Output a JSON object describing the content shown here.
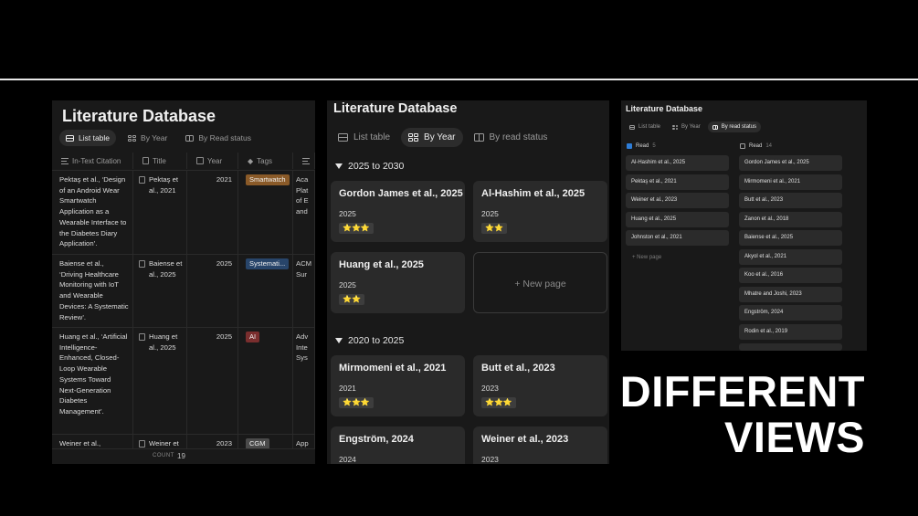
{
  "views": {
    "list": {
      "title": "Literature Database",
      "tabs": [
        {
          "label": "List table",
          "icon": "table-icon",
          "active": true
        },
        {
          "label": "By Year",
          "icon": "gallery-icon",
          "active": false
        },
        {
          "label": "By Read status",
          "icon": "board-icon",
          "active": false
        }
      ],
      "columns": [
        "In-Text Citation",
        "Title",
        "Year",
        "Tags",
        ""
      ],
      "rows": [
        {
          "citation": "Pektaş et al., ‘Design of an Android Wear Smartwatch Application as a Wearable Interface to the Diabetes Diary Application’.",
          "title": "Pektaş et al., 2021",
          "year": "2021",
          "tag": "Smartwatch",
          "tag_color": "#8a5a28",
          "more": "Aca Plat of E and"
        },
        {
          "citation": "Baiense et al., ‘Driving Healthcare Monitoring with IoT and Wearable Devices: A Systematic Review’.",
          "title": "Baiense et al., 2025",
          "year": "2025",
          "tag": "Systemati...",
          "tag_color": "#28456a",
          "more": "ACM Sur"
        },
        {
          "citation": "Huang et al., ‘Artificial Intelligence-Enhanced, Closed-Loop Wearable Systems Toward Next-Generation Diabetes Management’.",
          "title": "Huang et al., 2025",
          "year": "2025",
          "tag": "AI",
          "tag_color": "#7a2e2e",
          "more": "Adv Inte Sys"
        },
        {
          "citation": "Weiner et al.,",
          "title": "Weiner et",
          "year": "2023",
          "tag": "CGM",
          "tag_color": "#4a4a4a",
          "more": "App"
        }
      ],
      "count_label": "COUNT",
      "count_value": "19"
    },
    "by_year": {
      "title": "Literature Database",
      "tabs": [
        {
          "label": "List table",
          "icon": "table-icon",
          "active": false
        },
        {
          "label": "By Year",
          "icon": "gallery-icon",
          "active": true
        },
        {
          "label": "By read status",
          "icon": "board-icon",
          "active": false
        }
      ],
      "groups": [
        {
          "label": "2025 to 2030",
          "cards": [
            {
              "title": "Gordon James et al., 2025",
              "year": "2025",
              "rating": "⭐⭐⭐"
            },
            {
              "title": "Al-Hashim et al., 2025",
              "year": "2025",
              "rating": "⭐⭐"
            },
            {
              "title": "Huang et al., 2025",
              "year": "2025",
              "rating": "⭐⭐"
            }
          ],
          "new_page": "+ New page"
        },
        {
          "label": "2020 to 2025",
          "cards": [
            {
              "title": "Mirmomeni et al., 2021",
              "year": "2021",
              "rating": "⭐⭐⭐"
            },
            {
              "title": "Butt et al., 2023",
              "year": "2023",
              "rating": "⭐⭐⭐"
            },
            {
              "title": "Engström, 2024",
              "year": "2024",
              "rating": ""
            },
            {
              "title": "Weiner et al., 2023",
              "year": "2023",
              "rating": ""
            }
          ]
        }
      ]
    },
    "by_read_status": {
      "title": "Literature Database",
      "tabs": [
        {
          "label": "List table",
          "icon": "table-icon",
          "active": false
        },
        {
          "label": "By Year",
          "icon": "gallery-icon",
          "active": false
        },
        {
          "label": "By read status",
          "icon": "board-icon",
          "active": true
        }
      ],
      "columns": [
        {
          "label": "Read",
          "count": "5",
          "checked": true,
          "items": [
            "Al-Hashim et al., 2025",
            "Pektaş et al., 2021",
            "Weiner et al., 2023",
            "Huang et al., 2025",
            "Johnston et al., 2021"
          ],
          "new_page": "+ New page"
        },
        {
          "label": "Read",
          "count": "14",
          "checked": false,
          "items": [
            "Gordon James et al., 2025",
            "Mirmomeni et al., 2021",
            "Butt et al., 2023",
            "Zanon et al., 2018",
            "Baiense et al., 2025",
            "Akyol et al., 2021",
            "Koo et al., 2016",
            "Mhatre and Joshi, 2023",
            "Engström, 2024",
            "Rodin et al., 2019"
          ]
        }
      ]
    }
  },
  "headline": {
    "line1": "DIFFERENT",
    "line2": "VIEWS"
  },
  "colors": {
    "background": "#000000",
    "panel": "#191919",
    "card": "#2a2a2a",
    "checkbox": "#2e7dd7",
    "stars": "#f0c04a"
  }
}
